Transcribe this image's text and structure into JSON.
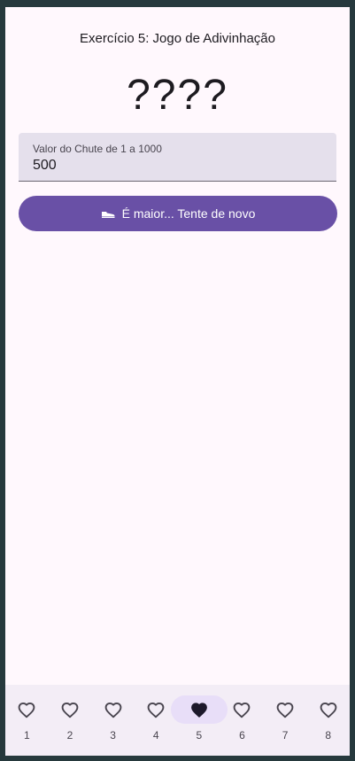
{
  "appbar": {
    "title": "Exercício 5: Jogo de Adivinhação"
  },
  "game": {
    "hidden_number": "????"
  },
  "guess_field": {
    "label": "Valor do Chute de 1 a 1000",
    "value": "500"
  },
  "action_button": {
    "label": "É maior... Tente de novo",
    "icon": "sneaker-icon"
  },
  "navbar": {
    "selected_index": 4,
    "items": [
      {
        "label": "1",
        "icon": "heart-outline-icon"
      },
      {
        "label": "2",
        "icon": "heart-outline-icon"
      },
      {
        "label": "3",
        "icon": "heart-outline-icon"
      },
      {
        "label": "4",
        "icon": "heart-outline-icon"
      },
      {
        "label": "5",
        "icon": "heart-filled-icon"
      },
      {
        "label": "6",
        "icon": "heart-outline-icon"
      },
      {
        "label": "7",
        "icon": "heart-outline-icon"
      },
      {
        "label": "8",
        "icon": "heart-outline-icon"
      }
    ]
  },
  "colors": {
    "background": "#fff8fd",
    "primary": "#6950a6",
    "field_fill": "#e5e0ec",
    "navbar": "#f3edf6",
    "nav_indicator": "#e8def8"
  }
}
